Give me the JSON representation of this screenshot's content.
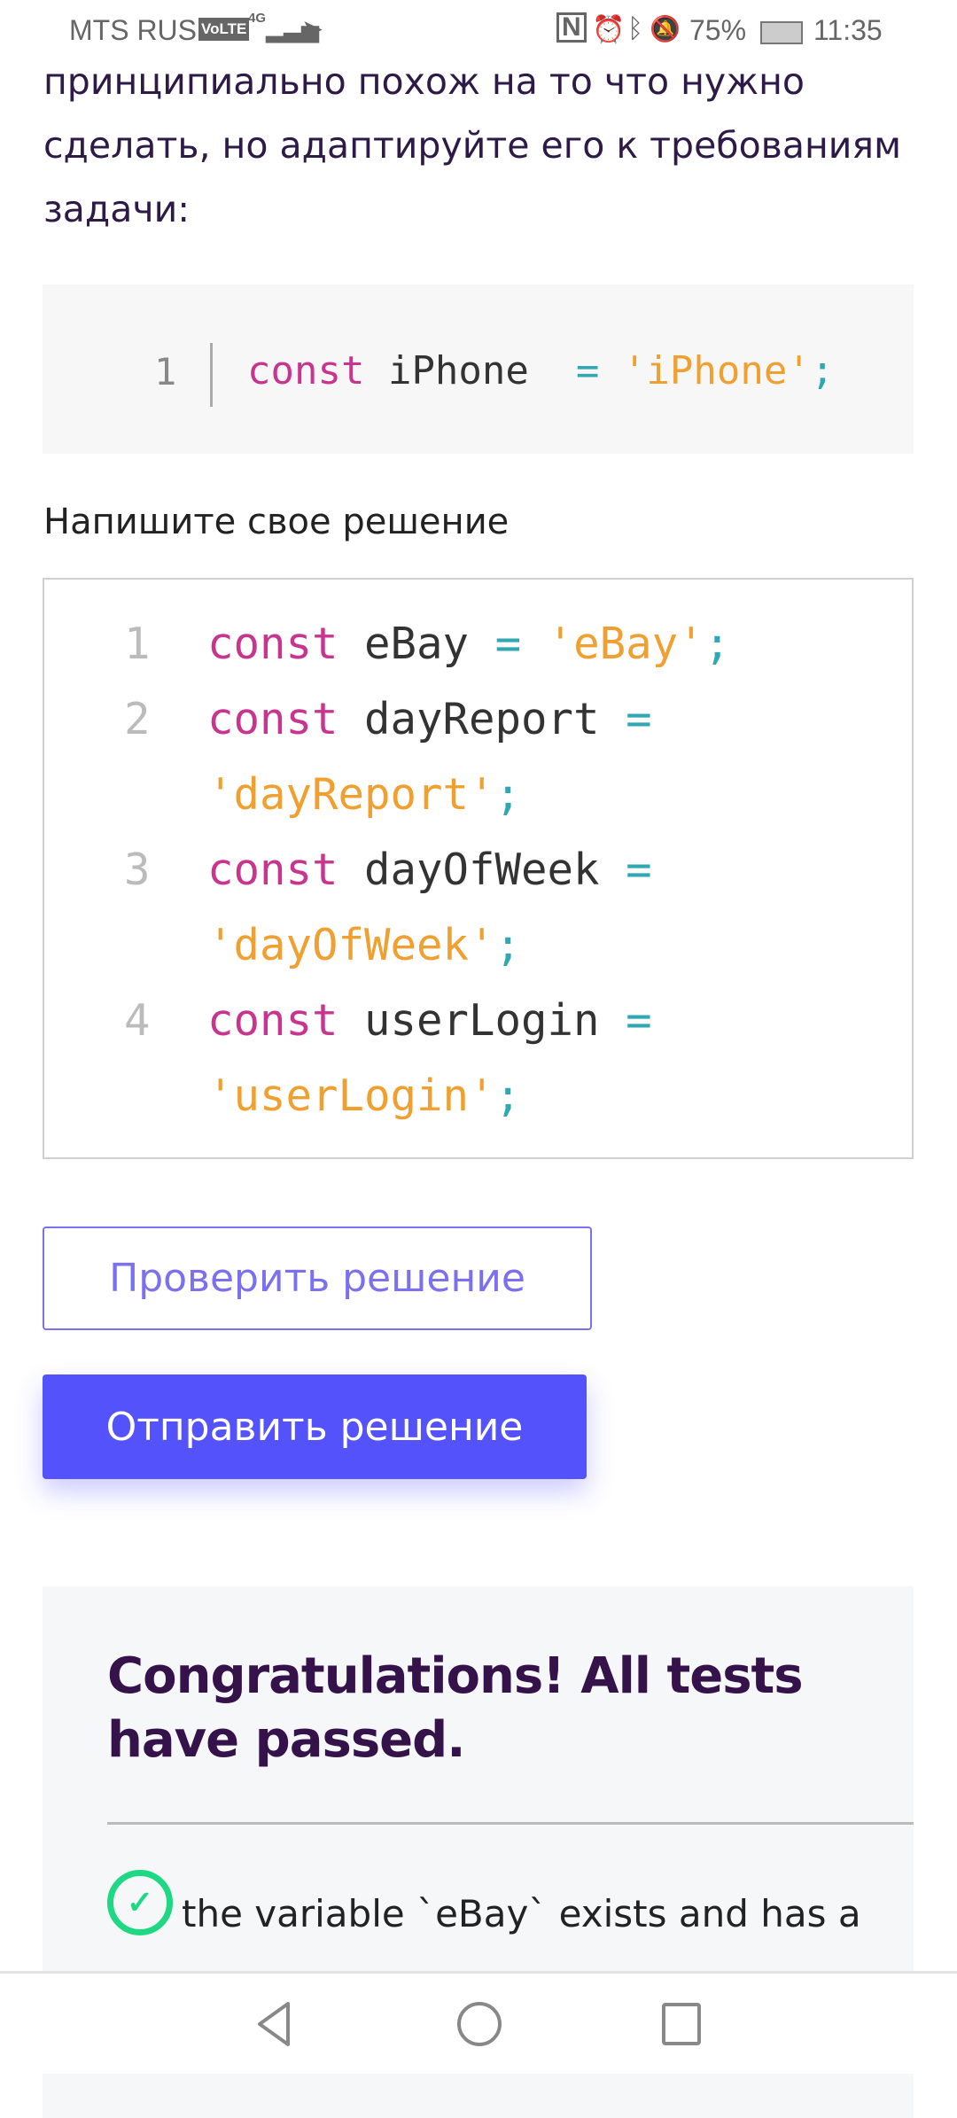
{
  "status_bar": {
    "carrier": "MTS RUS",
    "volte": "VoLTE",
    "network": "4G",
    "battery": "75%",
    "time": "11:35"
  },
  "intro_text": "принципиально похож на то что нужно сделать, но адаптируйте его к требованиям задачи:",
  "example": {
    "line_number": "1",
    "kw": "const",
    "name": "iPhone",
    "op": "=",
    "value": "'iPhone'",
    "semi": ";"
  },
  "editor_label": "Напишите свое решение",
  "editor": {
    "lines": [
      {
        "n": "1",
        "kw": "const",
        "name": "eBay",
        "op": "=",
        "value": "'eBay'",
        "semi": ";"
      },
      {
        "n": "2",
        "kw": "const",
        "name": "dayReport",
        "op": "=",
        "value": "'dayReport'",
        "semi": ";"
      },
      {
        "n": "3",
        "kw": "const",
        "name": "dayOfWeek",
        "op": "=",
        "value": "'dayOfWeek'",
        "semi": ";"
      },
      {
        "n": "4",
        "kw": "const",
        "name": "userLogin",
        "op": "=",
        "value": "'userLogin'",
        "semi": ";"
      }
    ]
  },
  "buttons": {
    "check": "Проверить решение",
    "submit": "Отправить решение"
  },
  "result": {
    "title": "Congratulations! All tests have passed.",
    "tests": [
      "the variable `eBay` exists and has a value"
    ]
  }
}
